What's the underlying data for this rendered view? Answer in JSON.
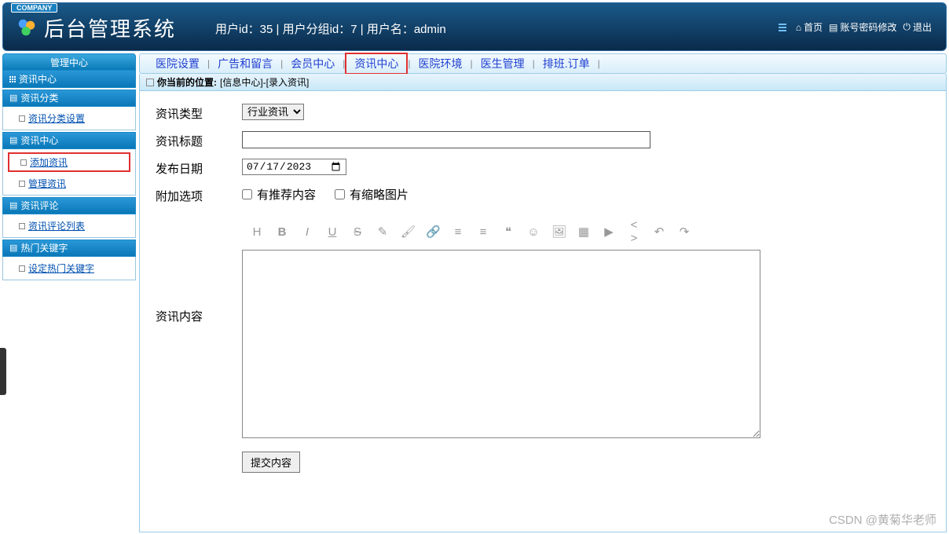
{
  "header": {
    "company_tag": "COMPANY",
    "system_title": "后台管理系统",
    "user_info": "用户id：35 | 用户分组id：7 | 用户名：admin",
    "home": "首页",
    "account": "账号密码修改",
    "logout": "退出"
  },
  "sidebar": {
    "mgmt_center": "管理中心",
    "news_center": "资讯中心",
    "groups": [
      {
        "title": "资讯分类",
        "items": [
          "资讯分类设置"
        ]
      },
      {
        "title": "资讯中心",
        "items": [
          "添加资讯",
          "管理资讯"
        ],
        "highlight": 0
      },
      {
        "title": "资讯评论",
        "items": [
          "资讯评论列表"
        ]
      },
      {
        "title": "热门关键字",
        "items": [
          "设定热门关键字"
        ]
      }
    ]
  },
  "tabs": [
    "医院设置",
    "广告和留言",
    "会员中心",
    "资讯中心",
    "医院环境",
    "医生管理",
    "排班.订单"
  ],
  "active_tab_index": 3,
  "breadcrumb": {
    "prefix": "你当前的位置:",
    "path": "[信息中心]-[录入资讯]"
  },
  "form": {
    "type_label": "资讯类型",
    "type_option": "行业资讯",
    "title_label": "资讯标题",
    "title_value": "",
    "date_label": "发布日期",
    "date_value": "2023/07/17",
    "extra_label": "附加选项",
    "checkbox1": "有推荐内容",
    "checkbox2": "有缩略图片",
    "content_label": "资讯内容",
    "submit": "提交内容"
  },
  "editor_toolbar": [
    "H",
    "B",
    "I",
    "U",
    "S",
    "✎",
    "🖌",
    "🔗",
    "≡",
    "≡",
    "❝",
    "☺",
    "🖼",
    "▦",
    "▶",
    "< >",
    "↶",
    "↷"
  ],
  "watermark": "CSDN @黄菊华老师"
}
